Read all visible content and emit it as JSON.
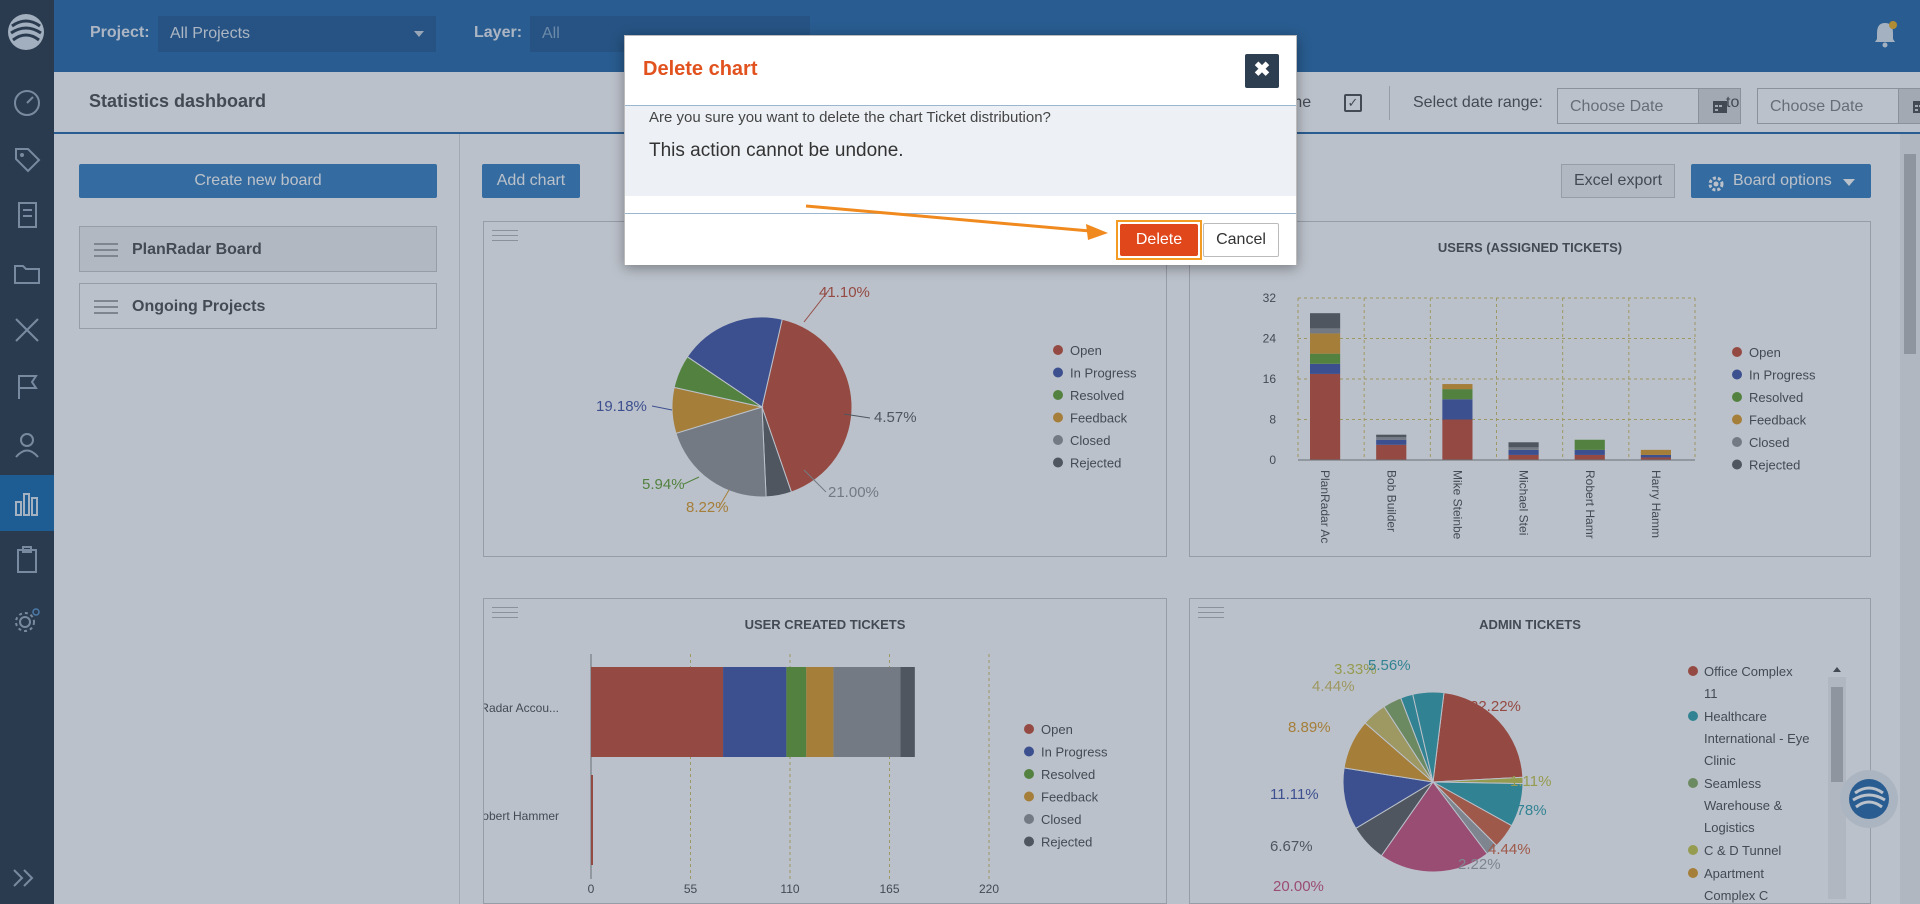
{
  "topbar": {
    "project_label": "Project:",
    "project_value": "All Projects",
    "layer_label": "Layer:",
    "layer_value": "All"
  },
  "subheader": {
    "title": "Statistics dashboard",
    "time_label": "t time",
    "time_checked": true,
    "date_range_label": "Select date range:",
    "date_from_placeholder": "Choose Date",
    "to_label": "to",
    "date_to_placeholder": "Choose Date"
  },
  "sidebar": {
    "create_button": "Create new board",
    "boards": [
      {
        "name": "PlanRadar Board",
        "selected": true
      },
      {
        "name": "Ongoing Projects",
        "selected": false
      }
    ]
  },
  "toolbar": {
    "add_chart": "Add chart",
    "excel_export": "Excel export",
    "board_options": "Board options"
  },
  "legend_statuses": [
    "Open",
    "In Progress",
    "Resolved",
    "Feedback",
    "Closed",
    "Rejected"
  ],
  "colors": {
    "open": "#c8553d",
    "in_progress": "#4a5dab",
    "resolved": "#6aa53a",
    "feedback": "#e0a030",
    "closed": "#9a9a9a",
    "rejected": "#666666",
    "accent": "#3e86c4",
    "danger": "#e0481c"
  },
  "charts": {
    "ticket_distribution": {
      "slice_labels": [
        "41.10%",
        "4.57%",
        "21.00%",
        "8.22%",
        "5.94%",
        "19.18%"
      ]
    },
    "users_assigned": {
      "title": "USERS (ASSIGNED TICKETS)",
      "y_ticks": [
        "0",
        "8",
        "16",
        "24",
        "32"
      ],
      "x_labels": [
        "PlanRadar Ac",
        "Bob Builder",
        "Mike Steinbe",
        "Michael Stei",
        "Robert Hamr",
        "Harry Hamm"
      ]
    },
    "user_created": {
      "title": "USER CREATED TICKETS",
      "y_labels": [
        "PlanRadar Accou...",
        "Robert Hammer"
      ],
      "x_ticks": [
        "0",
        "55",
        "110",
        "165",
        "220"
      ]
    },
    "admin_tickets": {
      "title": "ADMIN TICKETS",
      "slice_labels": [
        "22.22%",
        "1.11%",
        "7.78%",
        "4.44%",
        "2.22%",
        "20.00%",
        "6.67%",
        "11.11%",
        "8.89%",
        "4.44%",
        "3.33%",
        "5.56%"
      ],
      "legend": [
        "Office Complex 11",
        "Healthcare International - Eye Clinic",
        "Seamless Warehouse & Logistics",
        "C & D Tunnel",
        "Apartment Complex C"
      ]
    }
  },
  "chart_data": [
    {
      "type": "pie",
      "title": "",
      "categories": [
        "Open",
        "Rejected",
        "Closed",
        "Feedback",
        "Resolved",
        "In Progress"
      ],
      "values": [
        41.1,
        4.57,
        21.0,
        8.22,
        5.94,
        19.18
      ]
    },
    {
      "type": "bar",
      "title": "USERS (ASSIGNED TICKETS)",
      "categories": [
        "PlanRadar Ac",
        "Bob Builder",
        "Mike Steinbe",
        "Michael Stei",
        "Robert Hamr",
        "Harry Hamm"
      ],
      "series": [
        {
          "name": "Open",
          "values": [
            17,
            3,
            8,
            1,
            1,
            0.5
          ]
        },
        {
          "name": "In Progress",
          "values": [
            2,
            1,
            4,
            1,
            1,
            0.5
          ]
        },
        {
          "name": "Resolved",
          "values": [
            2,
            0,
            2,
            0,
            2,
            0
          ]
        },
        {
          "name": "Feedback",
          "values": [
            4,
            0,
            1,
            0,
            0,
            1
          ]
        },
        {
          "name": "Closed",
          "values": [
            1,
            0.5,
            0,
            0.5,
            0,
            0
          ]
        },
        {
          "name": "Rejected",
          "values": [
            3,
            0.5,
            0,
            1,
            0,
            0
          ]
        }
      ],
      "ylim": [
        0,
        32
      ],
      "stacked": true
    },
    {
      "type": "bar",
      "orientation": "horizontal",
      "title": "USER CREATED TICKETS",
      "categories": [
        "PlanRadar Accou...",
        "Robert Hammer"
      ],
      "series": [
        {
          "name": "Open",
          "values": [
            73,
            1
          ]
        },
        {
          "name": "In Progress",
          "values": [
            35,
            0
          ]
        },
        {
          "name": "Resolved",
          "values": [
            11,
            0
          ]
        },
        {
          "name": "Feedback",
          "values": [
            15,
            0
          ]
        },
        {
          "name": "Closed",
          "values": [
            37,
            0
          ]
        },
        {
          "name": "Rejected",
          "values": [
            8,
            0
          ]
        }
      ],
      "xlim": [
        0,
        220
      ],
      "stacked": true
    },
    {
      "type": "pie",
      "title": "ADMIN TICKETS",
      "values": [
        22.22,
        1.11,
        7.78,
        4.44,
        2.22,
        20.0,
        6.67,
        11.11,
        8.89,
        4.44,
        3.33,
        2.22,
        5.56
      ]
    }
  ],
  "modal": {
    "title": "Delete chart",
    "question": "Are you sure you want to delete the chart Ticket distribution?",
    "warning": "This action cannot be undone.",
    "delete_label": "Delete",
    "cancel_label": "Cancel",
    "close_glyph": "✖"
  }
}
